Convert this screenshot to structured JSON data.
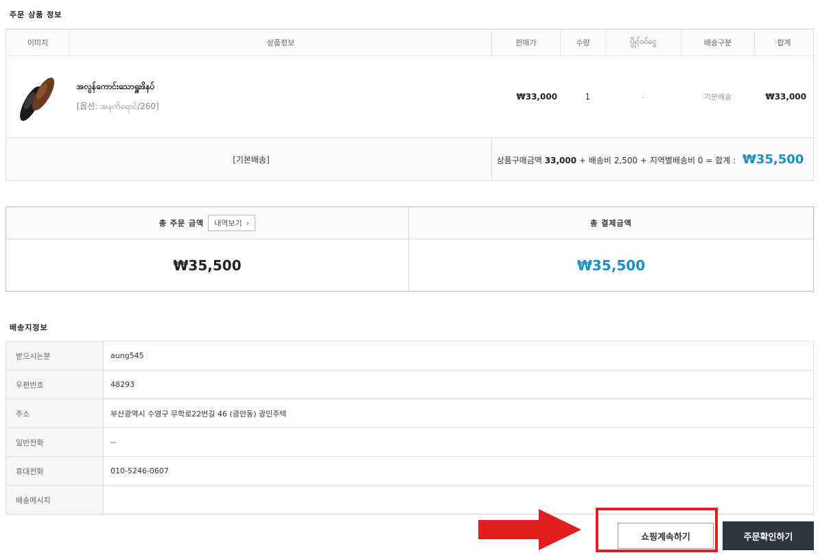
{
  "order_section": {
    "title": "주문 상품 정보",
    "headers": [
      "이미지",
      "상품정보",
      "판매가",
      "수량",
      "ပွိုင့်ဝင်ငွေ",
      "배송구분",
      "합계"
    ],
    "item": {
      "image_icon": "shoes-image",
      "name": "အလွန်ကောင်းသောရှူးဖိနပ်",
      "option": "[옵션: အနက်ရောင်/260]",
      "price": "₩33,000",
      "quantity": "1",
      "points": "-",
      "shipping_type": "기본배송",
      "total": "₩33,000"
    },
    "shipping_row": {
      "label": "[기본배송]",
      "purchase_label": "상품구매금액",
      "purchase_amount": "33,000",
      "plus1": "+",
      "shipping_fee": "배송비 2,500",
      "plus2": "+",
      "regional_fee": "지역별배송비 0",
      "equals": "= 합계 :",
      "total": "₩35,500"
    }
  },
  "totals": {
    "order_total_label": "총 주문 금액",
    "detail_button": "내역보기",
    "payment_total_label": "총 결제금액",
    "order_total_value": "₩35,500",
    "payment_total_value": "₩35,500",
    "accent_color": "#1b8fc4"
  },
  "address_section": {
    "title": "배송지정보",
    "rows": [
      {
        "label": "받으시는분",
        "value": "aung545"
      },
      {
        "label": "우편번호",
        "value": "48293"
      },
      {
        "label": "주소",
        "value": "부산광역시 수영구 무학로22번길 46 (광안동) 광민주택"
      },
      {
        "label": "일반전화",
        "value": "--"
      },
      {
        "label": "휴대전화",
        "value": "010-5246-0607"
      },
      {
        "label": "배송메시지",
        "value": ""
      }
    ]
  },
  "actions": {
    "continue_shopping": "쇼핑계속하기",
    "confirm_order": "주문확인하기",
    "highlight_color": "#e21d1d"
  }
}
